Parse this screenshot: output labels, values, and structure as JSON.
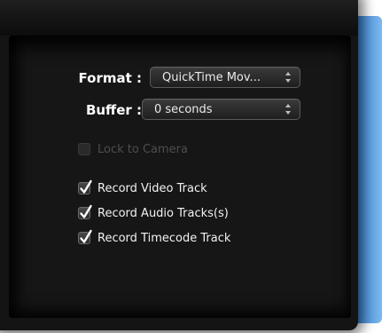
{
  "format": {
    "label": "Format :",
    "value": "QuickTime Mov..."
  },
  "buffer": {
    "label": "Buffer :",
    "value": "0 seconds"
  },
  "options": [
    {
      "label": "Lock to Camera",
      "checked": false,
      "enabled": false
    },
    {
      "label": "Record Video Track",
      "checked": true,
      "enabled": true
    },
    {
      "label": "Record Audio Tracks(s)",
      "checked": true,
      "enabled": true
    },
    {
      "label": "Record Timecode Track",
      "checked": true,
      "enabled": true
    }
  ],
  "colors": {
    "panel_background": "#141414",
    "label_text": "#ffffff",
    "disabled_text": "#4e4e4e",
    "window_edge_blue": "#4e97e0"
  },
  "icons": {
    "popup_arrows": "up-down-chevron-icon",
    "checkmark": "checkmark-icon"
  }
}
